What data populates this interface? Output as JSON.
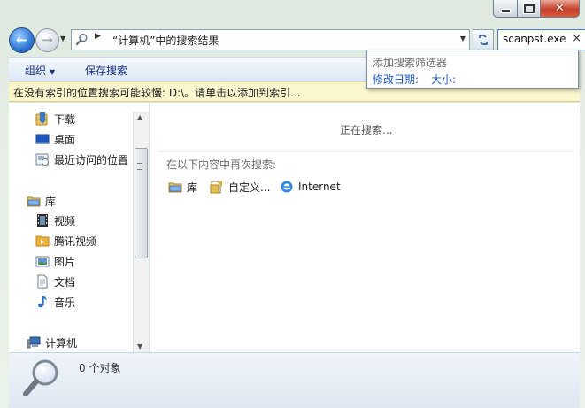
{
  "window": {
    "address_path": "“计算机”中的搜索结果",
    "search_value": "scanpst.exe",
    "search_clear": "×",
    "minimize_icon": "minimize-icon",
    "maximize_icon": "maximize-icon",
    "close_glyph": "✕"
  },
  "nav": {
    "back_glyph": "←",
    "forward_glyph": "→",
    "dropdown_glyph": "▼",
    "chevron_glyph": "▶"
  },
  "toolbar": {
    "organize_label": "组织",
    "organize_caret": "▼",
    "save_search_label": "保存搜索"
  },
  "filter_popup": {
    "title": "添加搜索筛选器",
    "date_modified": "修改日期:",
    "size": "大小:"
  },
  "infobar": {
    "text": "在没有索引的位置搜索可能较慢: D:\\。请单击以添加到索引..."
  },
  "navpane": {
    "favorites": [
      {
        "label": "下载",
        "icon": "downloads-folder-icon"
      },
      {
        "label": "桌面",
        "icon": "desktop-icon"
      },
      {
        "label": "最近访问的位置",
        "icon": "recent-places-icon"
      }
    ],
    "libraries": {
      "label": "库",
      "icon": "library-icon",
      "items": [
        {
          "label": "视频",
          "icon": "video-library-icon"
        },
        {
          "label": "腾讯视频",
          "icon": "tencent-video-icon"
        },
        {
          "label": "图片",
          "icon": "pictures-library-icon"
        },
        {
          "label": "文档",
          "icon": "documents-library-icon"
        },
        {
          "label": "音乐",
          "icon": "music-library-icon"
        }
      ]
    },
    "computer": {
      "label": "计算机",
      "icon": "computer-icon"
    },
    "scroll_up": "▲",
    "scroll_down": "▼"
  },
  "content": {
    "status": "正在搜索...",
    "search_again_label": "在以下内容中再次搜索:",
    "search_again_items": [
      {
        "label": "库",
        "icon": "library-icon"
      },
      {
        "label": "自定义...",
        "icon": "custom-folder-icon"
      },
      {
        "label": "Internet",
        "icon": "internet-explorer-icon"
      }
    ]
  },
  "details": {
    "count": "0 个对象",
    "icon": "search-magnifier-icon"
  }
}
